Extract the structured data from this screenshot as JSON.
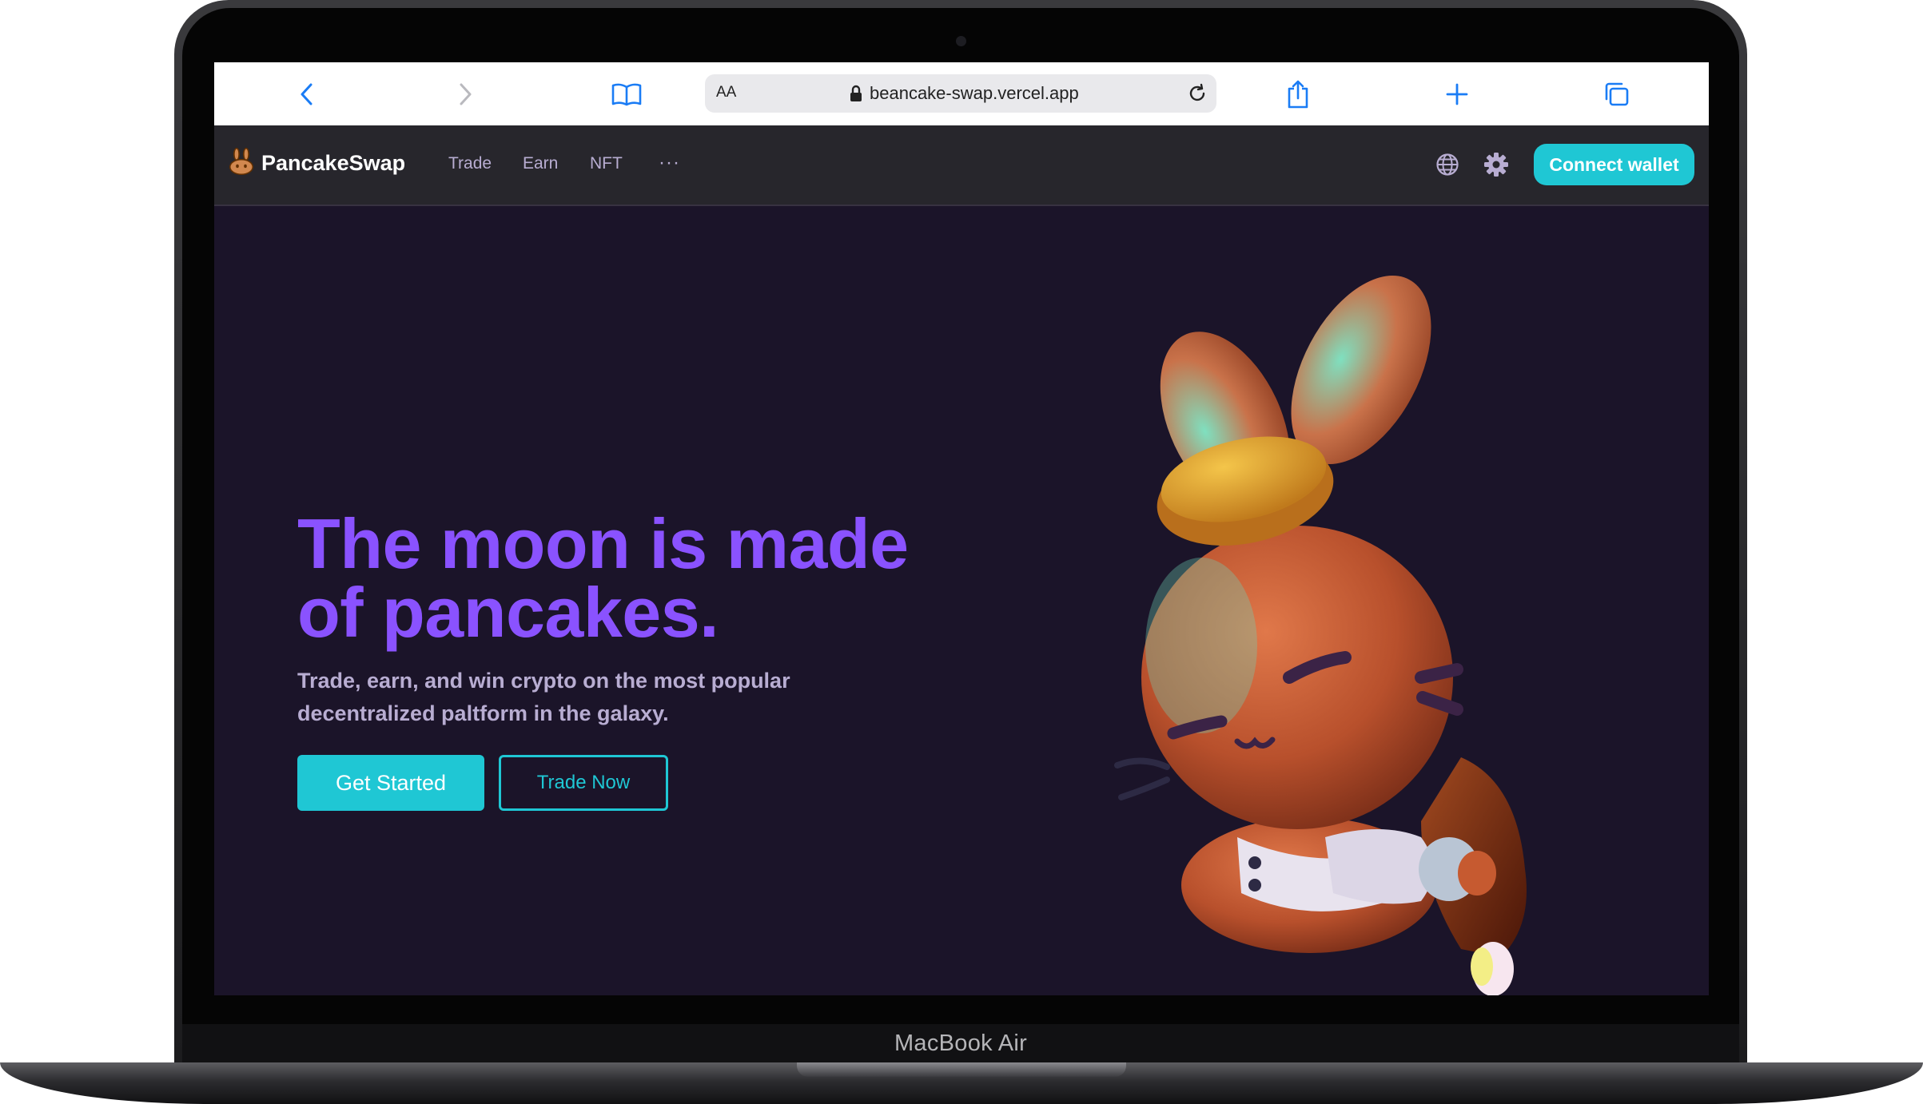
{
  "device": {
    "label": "MacBook Air"
  },
  "browser": {
    "reader_label": "AA",
    "url": "beancake-swap.vercel.app",
    "icons": [
      "back-icon",
      "forward-icon",
      "bookmarks-icon",
      "lock-icon",
      "reload-icon",
      "share-icon",
      "new-tab-icon",
      "tabs-icon"
    ]
  },
  "site": {
    "logo_text": "PancakeSwap",
    "nav": [
      "Trade",
      "Earn",
      "NFT"
    ],
    "more_label": "···",
    "connect_label": "Connect wallet",
    "icons": [
      "globe-icon",
      "settings-icon",
      "bunny-logo-icon"
    ]
  },
  "hero": {
    "title": "The moon is made of pancakes.",
    "subtitle": "Trade, earn, and win crypto on the most popular decentralized paltform in the galaxy.",
    "primary_button": "Get Started",
    "secondary_button": "Trade Now"
  },
  "colors": {
    "accent_primary": "#1fc7d4",
    "title_purple": "#8a52ff",
    "subtitle_lavender": "#b8add2",
    "page_bg": "#1b1429",
    "nav_bg": "#27262c"
  }
}
